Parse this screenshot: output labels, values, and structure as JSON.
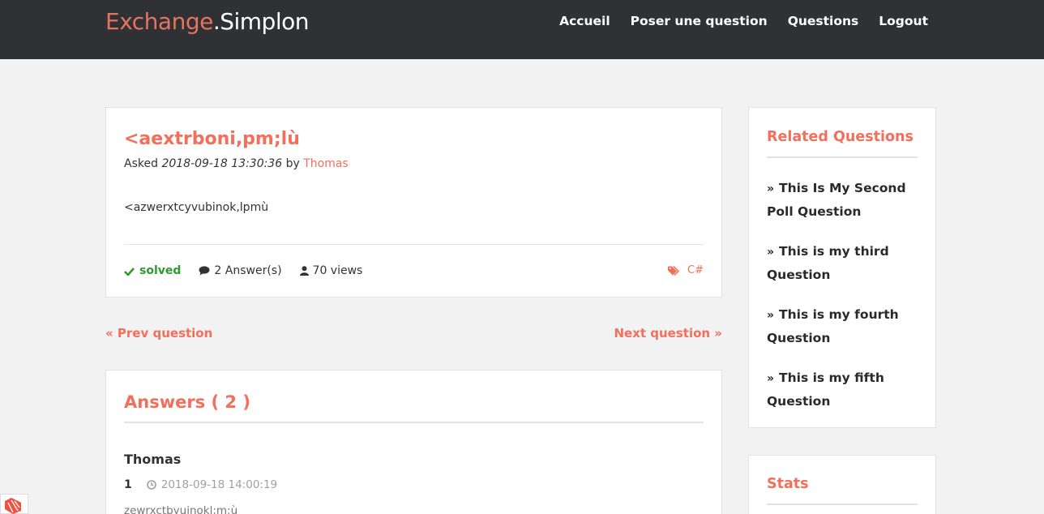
{
  "brand": {
    "part1": "Exchange",
    "part2": ".Simplon"
  },
  "nav": {
    "items": [
      "Accueil",
      "Poser une question",
      "Questions",
      "Logout"
    ]
  },
  "question": {
    "title": "<aextrboni,pm;lù",
    "asked_label": "Asked",
    "date": "2018-09-18 13:30:36",
    "by_label": "by",
    "author": "Thomas",
    "body": "<azwerxtcyvubinok,lpmù",
    "status": "solved",
    "answers": "2 Answer(s)",
    "views": "70 views",
    "tag": "C#"
  },
  "pager": {
    "prev": "« Prev question",
    "next": "Next question »"
  },
  "answers": {
    "title": "Answers ( 2 )",
    "first": {
      "author": "Thomas",
      "number": "1",
      "time": "2018-09-18 14:00:19",
      "body": "zewrxctbyuinokl;m:ù"
    }
  },
  "related": {
    "title": "Related Questions",
    "items": [
      "This Is My Second Poll Question",
      "This is my third Question",
      "This is my fourth Question",
      "This is my fifth Question"
    ]
  },
  "stats": {
    "title": "Stats"
  },
  "colors": {
    "accent": "#f26f5b",
    "header_bg": "#2f3135",
    "solved": "#2e9a2e"
  }
}
